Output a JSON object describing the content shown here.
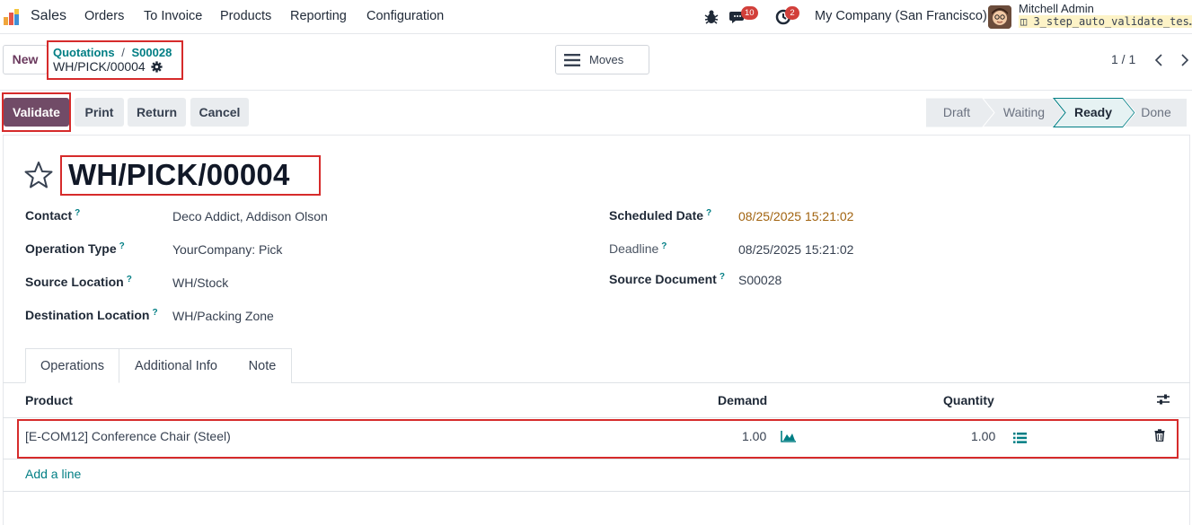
{
  "navbar": {
    "app_name": "Sales",
    "menu": [
      "Orders",
      "To Invoice",
      "Products",
      "Reporting",
      "Configuration"
    ],
    "messages_count": "10",
    "activities_count": "2",
    "company": "My Company (San Francisco)",
    "user_name": "Mitchell Admin",
    "database": "3_step_auto_validate_tes…"
  },
  "control_panel": {
    "new_label": "New",
    "breadcrumb_parent": "Quotations",
    "breadcrumb_separator": "/",
    "breadcrumb_order": "S00028",
    "breadcrumb_current": "WH/PICK/00004",
    "moves_label": "Moves",
    "pager": "1 / 1"
  },
  "actions": {
    "validate": "Validate",
    "print": "Print",
    "return": "Return",
    "cancel": "Cancel"
  },
  "statusbar": {
    "stages": [
      "Draft",
      "Waiting",
      "Ready",
      "Done"
    ],
    "current": "Ready"
  },
  "record": {
    "title": "WH/PICK/00004",
    "fields_left": [
      {
        "label": "Contact",
        "value": "Deco Addict, Addison Olson"
      },
      {
        "label": "Operation Type",
        "value": "YourCompany: Pick"
      },
      {
        "label": "Source Location",
        "value": "WH/Stock"
      },
      {
        "label": "Destination Location",
        "value": "WH/Packing Zone"
      }
    ],
    "fields_right": [
      {
        "label": "Scheduled Date",
        "value": "08/25/2025 15:21:02"
      },
      {
        "label": "Deadline",
        "value": "08/25/2025 15:21:02"
      },
      {
        "label": "Source Document",
        "value": "S00028"
      }
    ],
    "help_mark": "?"
  },
  "tabs": [
    "Operations",
    "Additional Info",
    "Note"
  ],
  "operations_table": {
    "columns": [
      "Product",
      "Demand",
      "Quantity"
    ],
    "rows": [
      {
        "product": "[E-COM12] Conference Chair (Steel)",
        "demand": "1.00",
        "quantity": "1.00"
      }
    ],
    "add_line": "Add a line"
  },
  "colors": {
    "brand": "#714b67",
    "accent": "#017e84",
    "highlight": "#d62b2b",
    "scheduled_date": "#a1630f"
  }
}
